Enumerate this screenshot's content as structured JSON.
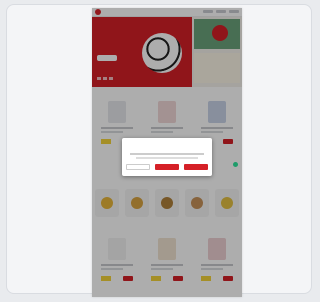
{
  "brand": {
    "name": "",
    "accent": "#d52027"
  },
  "hero": {
    "title": "",
    "cta": ""
  },
  "sections": [
    {
      "title": "",
      "link": ""
    },
    {
      "title": "",
      "link": ""
    },
    {
      "title": "",
      "link": ""
    }
  ],
  "modal": {
    "title": "",
    "decline": "",
    "settings": "",
    "accept": ""
  },
  "colors": {
    "red": "#d52027",
    "yellow": "#f3d33a",
    "green": "#1e9c6a"
  }
}
